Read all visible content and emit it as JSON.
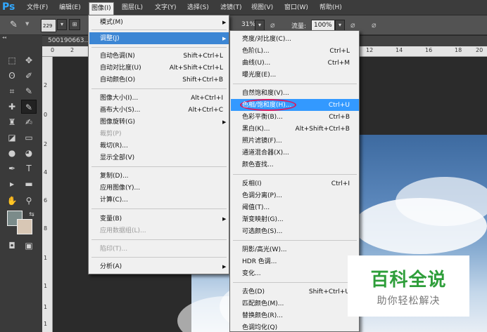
{
  "menubar": {
    "logo": "Ps",
    "items": [
      "文件(F)",
      "编辑(E)",
      "图像(I)",
      "图层(L)",
      "文字(Y)",
      "选择(S)",
      "滤镜(T)",
      "视图(V)",
      "窗口(W)",
      "帮助(H)"
    ]
  },
  "options": {
    "brush_size": "229",
    "opacity_value": "31%",
    "flow_label": "流量:",
    "flow_value": "100%"
  },
  "document": {
    "tab_title": "500190663..."
  },
  "ruler": {
    "top_marks": [
      "0",
      "2",
      "12",
      "14",
      "16",
      "18",
      "20"
    ],
    "left_marks": [
      "2",
      "0",
      "2",
      "4",
      "6",
      "8",
      "1",
      "1",
      "1",
      "1"
    ]
  },
  "image_menu": {
    "items": [
      {
        "label": "模式(M)",
        "shortcut": "",
        "submenu": true
      },
      {
        "label": "调整(J)",
        "shortcut": "",
        "submenu": true,
        "highlighted": true
      },
      {
        "label": "自动色调(N)",
        "shortcut": "Shift+Ctrl+L"
      },
      {
        "label": "自动对比度(U)",
        "shortcut": "Alt+Shift+Ctrl+L"
      },
      {
        "label": "自动颜色(O)",
        "shortcut": "Shift+Ctrl+B"
      },
      {
        "label": "图像大小(I)...",
        "shortcut": "Alt+Ctrl+I"
      },
      {
        "label": "画布大小(S)...",
        "shortcut": "Alt+Ctrl+C"
      },
      {
        "label": "图像旋转(G)",
        "shortcut": "",
        "submenu": true
      },
      {
        "label": "裁剪(P)",
        "shortcut": "",
        "disabled": true
      },
      {
        "label": "裁切(R)...",
        "shortcut": ""
      },
      {
        "label": "显示全部(V)",
        "shortcut": ""
      },
      {
        "label": "复制(D)...",
        "shortcut": ""
      },
      {
        "label": "应用图像(Y)...",
        "shortcut": ""
      },
      {
        "label": "计算(C)...",
        "shortcut": ""
      },
      {
        "label": "变量(B)",
        "shortcut": "",
        "submenu": true
      },
      {
        "label": "应用数据组(L)...",
        "shortcut": "",
        "disabled": true
      },
      {
        "label": "陷印(T)...",
        "shortcut": "",
        "disabled": true
      },
      {
        "label": "分析(A)",
        "shortcut": "",
        "submenu": true
      }
    ]
  },
  "adjust_menu": {
    "items": [
      {
        "label": "亮度/对比度(C)...",
        "shortcut": ""
      },
      {
        "label": "色阶(L)...",
        "shortcut": "Ctrl+L"
      },
      {
        "label": "曲线(U)...",
        "shortcut": "Ctrl+M"
      },
      {
        "label": "曝光度(E)...",
        "shortcut": ""
      },
      {
        "label": "自然饱和度(V)...",
        "shortcut": ""
      },
      {
        "label": "色相/饱和度(H)...",
        "shortcut": "Ctrl+U",
        "highlighted": true
      },
      {
        "label": "色彩平衡(B)...",
        "shortcut": "Ctrl+B"
      },
      {
        "label": "黑白(K)...",
        "shortcut": "Alt+Shift+Ctrl+B"
      },
      {
        "label": "照片滤镜(F)...",
        "shortcut": ""
      },
      {
        "label": "通道混合器(X)...",
        "shortcut": ""
      },
      {
        "label": "颜色查找...",
        "shortcut": ""
      },
      {
        "label": "反相(I)",
        "shortcut": "Ctrl+I"
      },
      {
        "label": "色调分离(P)...",
        "shortcut": ""
      },
      {
        "label": "阈值(T)...",
        "shortcut": ""
      },
      {
        "label": "渐变映射(G)...",
        "shortcut": ""
      },
      {
        "label": "可选颜色(S)...",
        "shortcut": ""
      },
      {
        "label": "阴影/高光(W)...",
        "shortcut": ""
      },
      {
        "label": "HDR 色调...",
        "shortcut": ""
      },
      {
        "label": "变化...",
        "shortcut": ""
      },
      {
        "label": "去色(D)",
        "shortcut": "Shift+Ctrl+U"
      },
      {
        "label": "匹配颜色(M)...",
        "shortcut": ""
      },
      {
        "label": "替换颜色(R)...",
        "shortcut": ""
      },
      {
        "label": "色调均化(Q)",
        "shortcut": ""
      }
    ]
  },
  "watermark": {
    "title": "百科全说",
    "subtitle": "助你轻松解决"
  },
  "colors": {
    "highlight": "#3399ff",
    "annotation": "#d81b60",
    "watermark_green": "#2e9e3a"
  }
}
